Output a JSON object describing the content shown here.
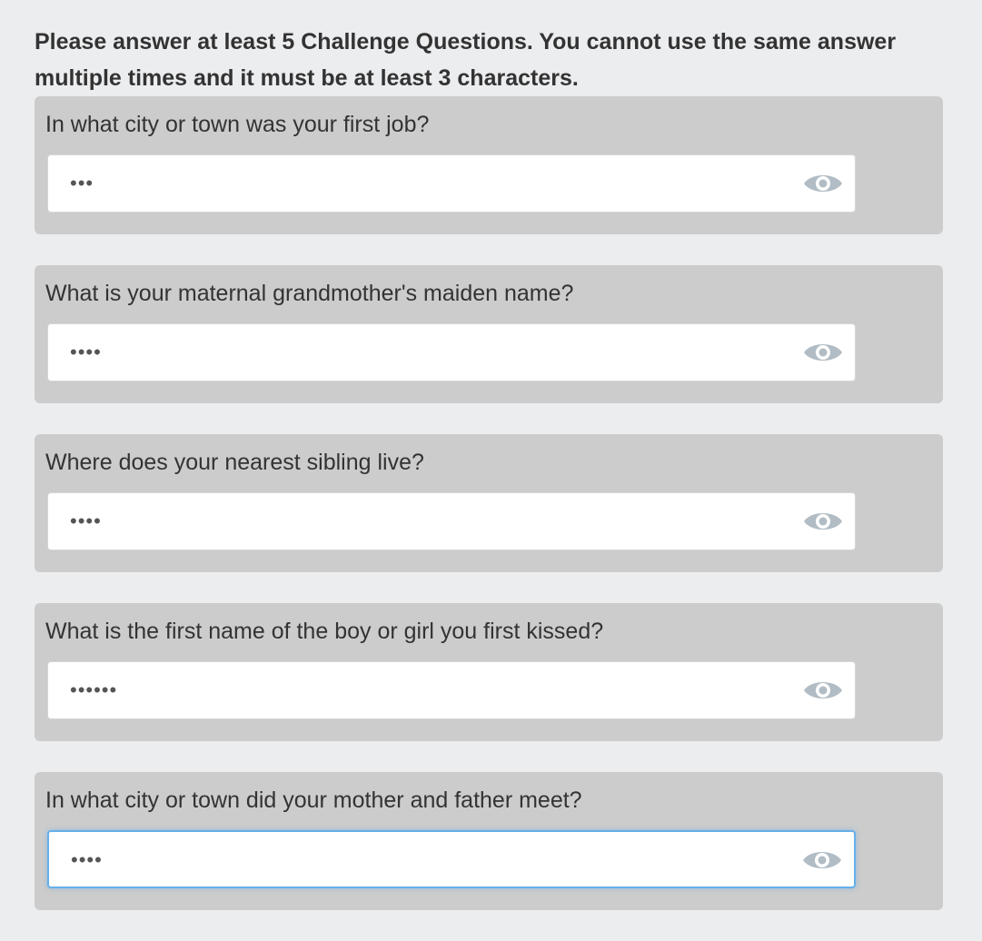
{
  "instructions": "Please answer at least 5 Challenge Questions. You cannot use the same answer multiple times and it must be at least 3 characters.",
  "questions": [
    {
      "label": "In what city or town was your first job?",
      "masked_value": "•••"
    },
    {
      "label": "What is your maternal grandmother's maiden name?",
      "masked_value": "••••"
    },
    {
      "label": "Where does your nearest sibling live?",
      "masked_value": "••••"
    },
    {
      "label": "What is the first name of the boy or girl you first kissed?",
      "masked_value": "••••••"
    },
    {
      "label": "In what city or town did your mother and father meet?",
      "masked_value": "••••"
    }
  ],
  "focused_question_index": 4,
  "icons": {
    "reveal": "eye-icon"
  },
  "colors": {
    "page_background": "#ecedef",
    "panel_background": "#cccccc",
    "focus_border": "#66afe9",
    "eye_icon": "#b1bcc4"
  }
}
